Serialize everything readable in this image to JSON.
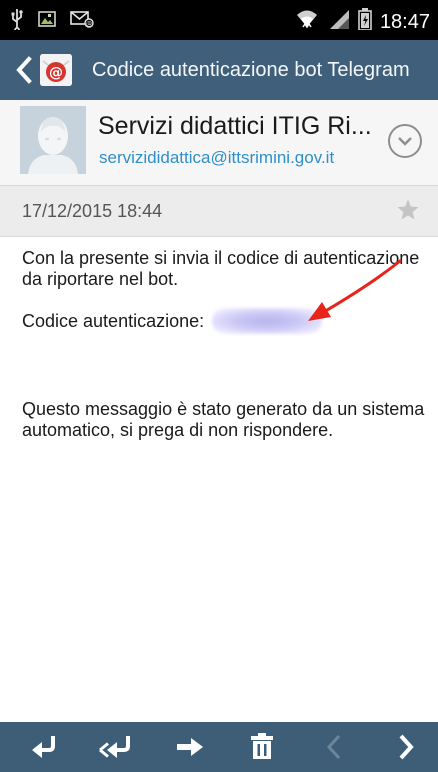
{
  "status_bar": {
    "time": "18:47",
    "icons": [
      "usb-icon",
      "image-notification-icon",
      "email-notification-icon",
      "wifi-icon",
      "signal-icon",
      "battery-icon"
    ]
  },
  "action_bar": {
    "title": "Codice autenticazione bot Telegram",
    "back_icon": "chevron-left-icon",
    "app_icon": "email-app-icon"
  },
  "sender": {
    "name": "Servizi didattici ITIG Ri...",
    "email": "servizididattica@ittsrimini.gov.it",
    "expand_icon": "chevron-down-circle-icon"
  },
  "meta": {
    "date": "17/12/2015 18:44",
    "star_icon": "star-icon"
  },
  "message": {
    "paragraph1": "Con la presente si invia il codice di autenticazione da riportare nel bot.",
    "code_label": "Codice autenticazione:",
    "paragraph2": "Questo messaggio è stato generato da un sistema automatico, si prega di non rispondere."
  },
  "annotation": {
    "arrow_color": "#e8231b"
  },
  "toolbar": {
    "buttons": [
      "reply-icon",
      "reply-all-icon",
      "forward-icon",
      "delete-icon",
      "previous-icon",
      "next-icon"
    ]
  },
  "colors": {
    "action_bar": "#3f5f7a",
    "toolbar": "#3e5e78",
    "link": "#2f8fc8"
  }
}
